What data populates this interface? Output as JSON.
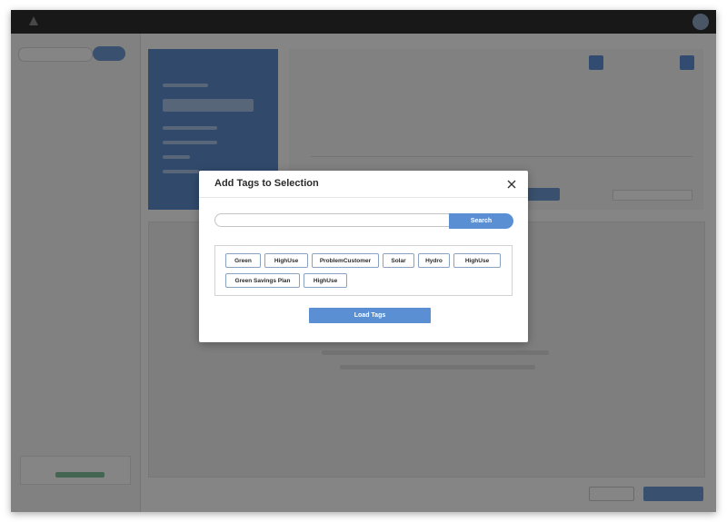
{
  "modal": {
    "title": "Add Tags to Selection",
    "search_placeholder": "",
    "search_button": "Search",
    "tags": [
      "Green",
      "HighUse",
      "ProblemCustomer",
      "Solar",
      "Hydro",
      "HighUse",
      "Green Savings Plan",
      "HighUse"
    ],
    "load_button": "Load Tags",
    "close_icon": "close-icon"
  },
  "colors": {
    "accent": "#5b8fd3",
    "topbar": "#2e2e2e",
    "summary_panel": "#5e8fd0",
    "overlay": "rgba(0,0,0,0.48)"
  }
}
